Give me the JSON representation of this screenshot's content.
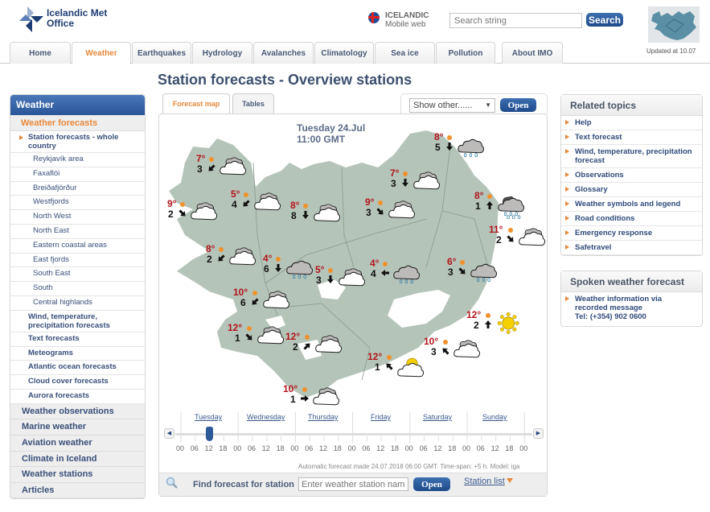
{
  "header": {
    "logo_line1": "Icelandic Met",
    "logo_line2": "Office",
    "lang_title": "ICELANDIC",
    "lang_sub": "Mobile web",
    "search_placeholder": "Search string",
    "search_button": "Search",
    "updated": "Updated at 10.07"
  },
  "nav": {
    "tabs": [
      {
        "label": "Home"
      },
      {
        "label": "Weather",
        "active": true
      },
      {
        "label": "Earthquakes"
      },
      {
        "label": "Hydrology"
      },
      {
        "label": "Avalanches"
      },
      {
        "label": "Climatology"
      },
      {
        "label": "Sea ice"
      },
      {
        "label": "Pollution"
      },
      {
        "label": "About IMO"
      }
    ]
  },
  "sidebar": {
    "header": "Weather",
    "section": "Weather forecasts",
    "items": [
      {
        "label": "Station forecasts - whole country",
        "level": "cur"
      },
      {
        "label": "Reykjavík area",
        "level": "l2"
      },
      {
        "label": "Faxaflói",
        "level": "l2"
      },
      {
        "label": "Breiðafjörður",
        "level": "l2"
      },
      {
        "label": "Westfjords",
        "level": "l2"
      },
      {
        "label": "North West",
        "level": "l2"
      },
      {
        "label": "North East",
        "level": "l2"
      },
      {
        "label": "Eastern coastal areas",
        "level": "l2"
      },
      {
        "label": "East fjords",
        "level": "l2"
      },
      {
        "label": "South East",
        "level": "l2"
      },
      {
        "label": "South",
        "level": "l2"
      },
      {
        "label": "Central highlands",
        "level": "l2"
      },
      {
        "label": "Wind, temperature, precipitation forecasts",
        "level": "l1"
      },
      {
        "label": "Text forecasts",
        "level": "l1"
      },
      {
        "label": "Meteograms",
        "level": "l1"
      },
      {
        "label": "Atlantic ocean forecasts",
        "level": "l1"
      },
      {
        "label": "Cloud cover forecasts",
        "level": "l1"
      },
      {
        "label": "Aurora forecasts",
        "level": "l1"
      }
    ],
    "main_items": [
      "Weather observations",
      "Marine weather",
      "Aviation weather",
      "Climate in Iceland",
      "Weather stations",
      "Articles"
    ]
  },
  "main": {
    "title": "Station forecasts - Overview stations",
    "tabs": [
      {
        "label": "Forecast map",
        "active": true
      },
      {
        "label": "Tables"
      }
    ],
    "show_other": "Show other......",
    "open_button": "Open",
    "date_line1": "Tuesday 24.Jul",
    "date_line2": "11:00 GMT",
    "stations": [
      {
        "temp": "7°",
        "wind": "3",
        "dir": "sw",
        "icon": "cloudy"
      },
      {
        "temp": "9°",
        "wind": "2",
        "dir": "se",
        "icon": "cloudy"
      },
      {
        "temp": "5°",
        "wind": "4",
        "dir": "sw",
        "icon": "cloudy"
      },
      {
        "temp": "8°",
        "wind": "8",
        "dir": "s",
        "icon": "cloudy"
      },
      {
        "temp": "8°",
        "wind": "5",
        "dir": "s",
        "icon": "rain"
      },
      {
        "temp": "7°",
        "wind": "3",
        "dir": "s",
        "icon": "cloudy"
      },
      {
        "temp": "9°",
        "wind": "3",
        "dir": "se",
        "icon": "cloudy"
      },
      {
        "temp": "8°",
        "wind": "1",
        "dir": "n",
        "icon": "heavy-rain"
      },
      {
        "temp": "11°",
        "wind": "2",
        "dir": "se",
        "icon": "cloudy"
      },
      {
        "temp": "8°",
        "wind": "2",
        "dir": "sw",
        "icon": "cloudy"
      },
      {
        "temp": "4°",
        "wind": "6",
        "dir": "s",
        "icon": "rain"
      },
      {
        "temp": "5°",
        "wind": "3",
        "dir": "s",
        "icon": "cloudy"
      },
      {
        "temp": "4°",
        "wind": "4",
        "dir": "w",
        "icon": "rain"
      },
      {
        "temp": "6°",
        "wind": "3",
        "dir": "se",
        "icon": "rain"
      },
      {
        "temp": "10°",
        "wind": "6",
        "dir": "sw",
        "icon": "cloudy"
      },
      {
        "temp": "12°",
        "wind": "1",
        "dir": "se",
        "icon": "cloudy"
      },
      {
        "temp": "12°",
        "wind": "2",
        "dir": "ne",
        "icon": "cloudy"
      },
      {
        "temp": "12°",
        "wind": "2",
        "dir": "n",
        "icon": "sun"
      },
      {
        "temp": "10°",
        "wind": "3",
        "dir": "nw",
        "icon": "cloudy"
      },
      {
        "temp": "12°",
        "wind": "1",
        "dir": "nw",
        "icon": "partly-sunny"
      },
      {
        "temp": "10°",
        "wind": "1",
        "dir": "e",
        "icon": "cloudy"
      }
    ],
    "timeline": {
      "days": [
        "Tuesday",
        "Wednesday",
        "Thursday",
        "Friday",
        "Saturday",
        "Sunday"
      ],
      "hours": [
        "00",
        "06",
        "12",
        "18",
        "00",
        "06",
        "12",
        "18",
        "00",
        "06",
        "12",
        "18",
        "00",
        "06",
        "12",
        "18",
        "00",
        "06",
        "12",
        "18",
        "00",
        "06",
        "12",
        "18",
        "00"
      ],
      "selected_hour_index": 2
    },
    "auto_note": "Automatic forecast made 24.07.2018 06:00 GMT. Time-span: +5 h. Model: iga",
    "find_label": "Find forecast for station",
    "find_placeholder": "Enter weather station name",
    "find_button": "Open",
    "station_list": "Station list"
  },
  "related": {
    "header": "Related topics",
    "items": [
      "Help",
      "Text forecast",
      "Wind, temperature, precipitation forecast",
      "Observations",
      "Glossary",
      "Weather symbols and legend",
      "Road conditions",
      "Emergency response",
      "Safetravel"
    ]
  },
  "spoken": {
    "header": "Spoken weather forecast",
    "line1": "Weather information via",
    "line2": "recorded message",
    "line3": "Tel: (+354) 902 0600"
  },
  "colors": {
    "accent": "#e8883a",
    "brand": "#2a5699",
    "temp": "#b2141b",
    "map_land": "#b5c4b9"
  }
}
